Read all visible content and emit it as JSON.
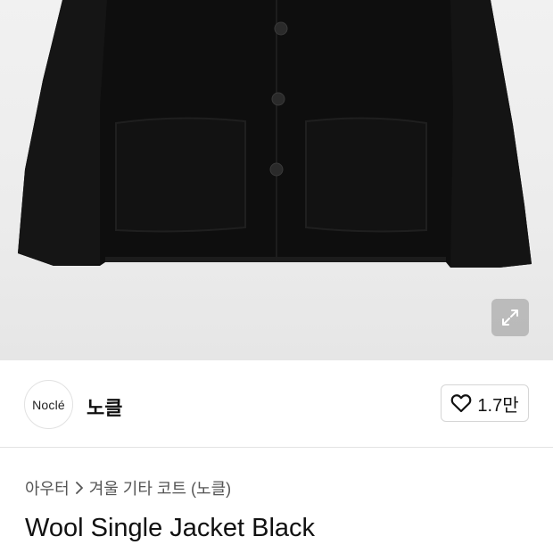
{
  "product_image": {
    "alt": "",
    "expand_icon": "expand-arrows-icon"
  },
  "brand": {
    "logo_text": "Noclé",
    "name": "노클",
    "like_icon": "heart-outline-icon",
    "like_count": "1.7만"
  },
  "category": {
    "items": [
      "아우터",
      "겨울 기타 코트 (노클)"
    ],
    "separator_icon": "chevron-right-icon"
  },
  "product": {
    "title": "Wool Single Jacket Black"
  },
  "colors": {
    "image_background": "#ececec",
    "jacket": "#0f0f0f",
    "divider": "#e3e3e3"
  }
}
